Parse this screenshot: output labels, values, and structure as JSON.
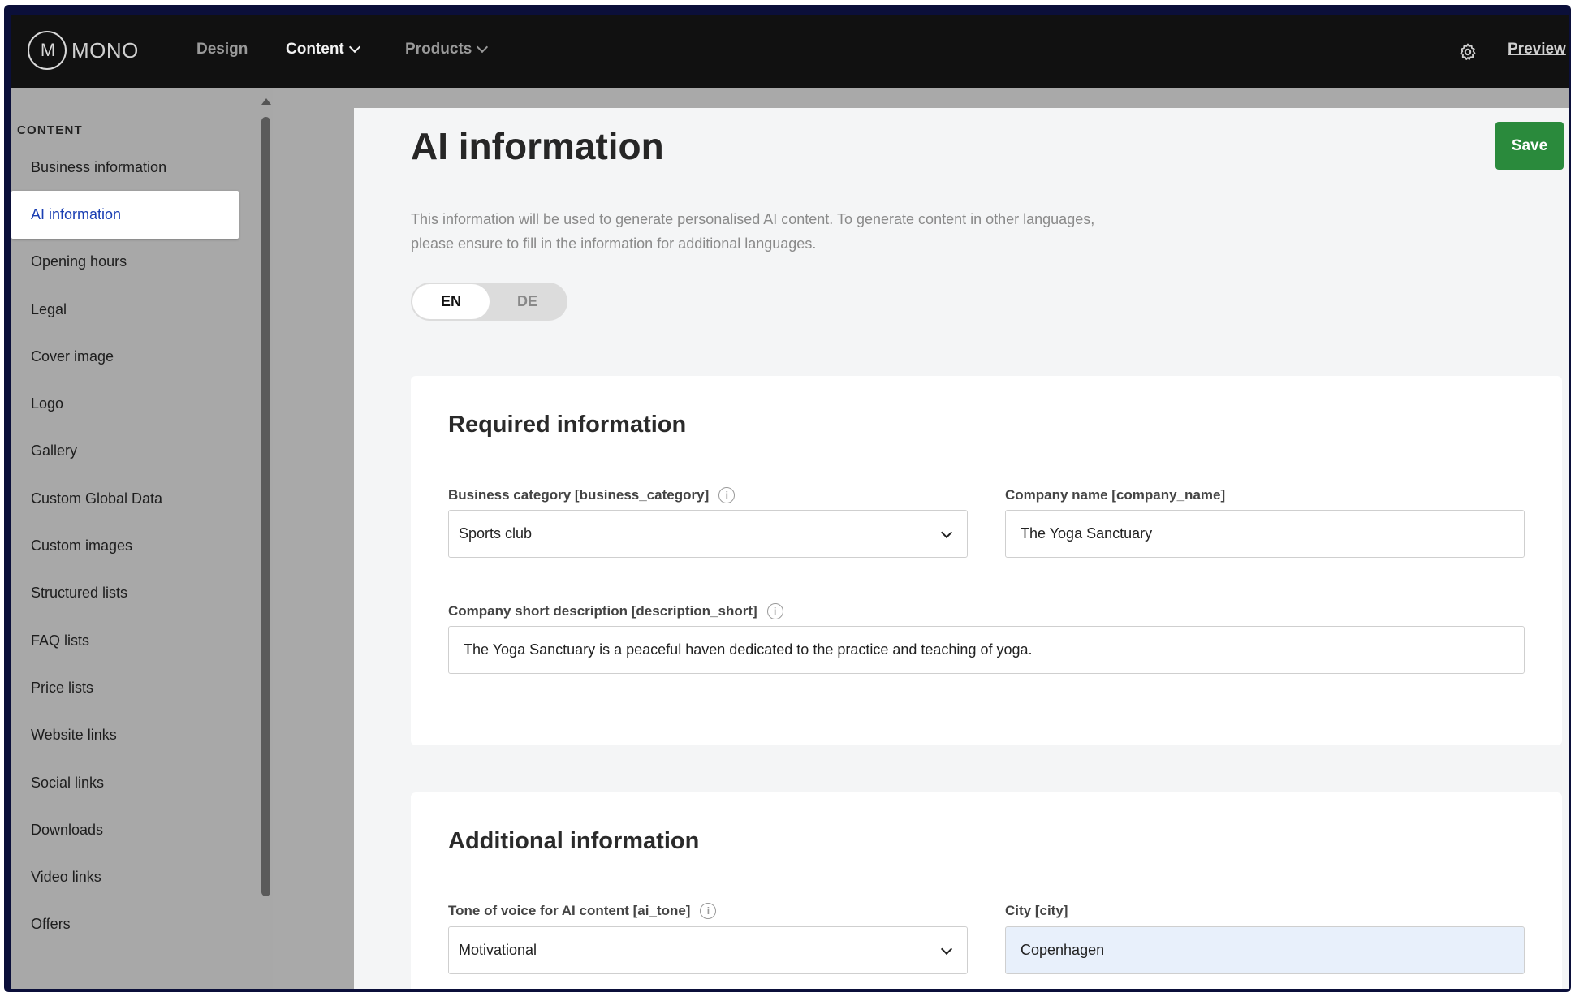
{
  "nav": {
    "logo_mark": "M",
    "logo_text": "MONO",
    "items": [
      {
        "label": "Design"
      },
      {
        "label": "Content"
      },
      {
        "label": "Products"
      }
    ],
    "preview_label": "Preview"
  },
  "sidebar": {
    "heading": "CONTENT",
    "items": [
      {
        "label": "Business information"
      },
      {
        "label": "AI information"
      },
      {
        "label": "Opening hours"
      },
      {
        "label": "Legal"
      },
      {
        "label": "Cover image"
      },
      {
        "label": "Logo"
      },
      {
        "label": "Gallery"
      },
      {
        "label": "Custom Global Data"
      },
      {
        "label": "Custom images"
      },
      {
        "label": "Structured lists"
      },
      {
        "label": "FAQ lists"
      },
      {
        "label": "Price lists"
      },
      {
        "label": "Website links"
      },
      {
        "label": "Social links"
      },
      {
        "label": "Downloads"
      },
      {
        "label": "Video links"
      },
      {
        "label": "Offers"
      }
    ],
    "active_index": 1
  },
  "main": {
    "title": "AI information",
    "save_label": "Save",
    "intro_line1": "This information will be used to generate personalised AI content. To generate content in other languages,",
    "intro_line2": "please ensure to fill in the information for additional languages.",
    "languages": [
      "EN",
      "DE"
    ],
    "active_language": "EN",
    "required": {
      "title": "Required information",
      "business_category_label": "Business category [business_category]",
      "business_category_value": "Sports club",
      "company_name_label": "Company name [company_name]",
      "company_name_value": "The Yoga Sanctuary",
      "short_description_label": "Company short description [description_short]",
      "short_description_value": "The Yoga Sanctuary is a peaceful haven dedicated to the practice and teaching of yoga."
    },
    "additional": {
      "title": "Additional information",
      "tone_label": "Tone of voice for AI content [ai_tone]",
      "tone_value": "Motivational",
      "city_label": "City [city]",
      "city_value": "Copenhagen"
    }
  },
  "colors": {
    "nav_bg": "#111111",
    "accent_blue": "#1b3fb3",
    "save_green": "#2a8a3c",
    "frame": "#0b0f3a"
  },
  "icons": [
    "logo-mark-icon",
    "chevron-down-icon",
    "gear-icon",
    "info-icon",
    "scroll-up-arrow-icon"
  ]
}
